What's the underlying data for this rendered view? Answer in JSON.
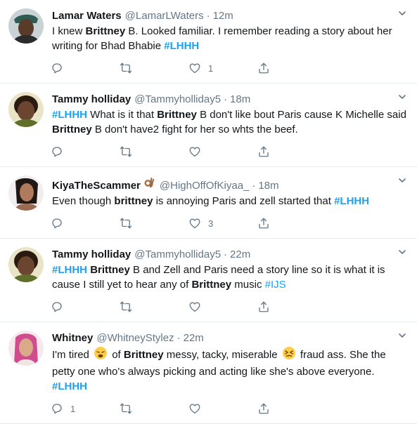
{
  "tweets": [
    {
      "name": "Lamar Waters",
      "handle": "@LamarLWaters",
      "dot": "·",
      "time": "12m",
      "parts": [
        {
          "t": "I knew "
        },
        {
          "t": "Brittney",
          "b": true
        },
        {
          "t": " B. Looked familiar. I remember reading a story about her writing for Bhad Bhabie "
        },
        {
          "t": "#LHHH",
          "tag": true,
          "bold": true
        }
      ],
      "replies": "",
      "retweets": "",
      "likes": "1"
    },
    {
      "name": "Tammy holliday",
      "handle": "@Tammyholliday5",
      "dot": "·",
      "time": "18m",
      "parts": [
        {
          "t": "#LHHH",
          "tag": true,
          "bold": true
        },
        {
          "t": " What is it that "
        },
        {
          "t": "Brittney",
          "b": true
        },
        {
          "t": " B don't like bout Paris cause K Michelle said "
        },
        {
          "t": "Brittney",
          "b": true
        },
        {
          "t": " B don't have2 fight for her so whts the beef."
        }
      ],
      "replies": "",
      "retweets": "",
      "likes": ""
    },
    {
      "name": "KiyaTheScammer",
      "handle": "@HighOffOfKiyaa_",
      "dot": "·",
      "time": "18m",
      "name_emoji": "ok-hand-emoji",
      "parts": [
        {
          "t": "Even though "
        },
        {
          "t": "brittney",
          "b": true
        },
        {
          "t": " is annoying Paris and zell started that "
        },
        {
          "t": "#LHHH",
          "tag": true,
          "bold": true
        }
      ],
      "replies": "",
      "retweets": "",
      "likes": "3"
    },
    {
      "name": "Tammy holliday",
      "handle": "@Tammyholliday5",
      "dot": "·",
      "time": "22m",
      "parts": [
        {
          "t": "#LHHH",
          "tag": true,
          "bold": true
        },
        {
          "t": " "
        },
        {
          "t": "Brittney",
          "b": true
        },
        {
          "t": " B and Zell and Paris need a story line so it is what it is cause I still yet to hear any of "
        },
        {
          "t": "Brittney",
          "b": true
        },
        {
          "t": " music "
        },
        {
          "t": "#IJS",
          "tag": true,
          "bold": false
        }
      ],
      "replies": "",
      "retweets": "",
      "likes": ""
    },
    {
      "name": "Whitney",
      "handle": "@WhitneyStylez",
      "dot": "·",
      "time": "22m",
      "parts": [
        {
          "t": "I'm tired "
        },
        {
          "emoji": "tired-face-emoji"
        },
        {
          "t": " of "
        },
        {
          "t": "Brittney",
          "b": true
        },
        {
          "t": " messy, tacky, miserable "
        },
        {
          "emoji": "persevering-face-emoji"
        },
        {
          "t": " fraud ass. She the petty one who's always picking and acting like she's above everyone.  "
        },
        {
          "t": "#LHHH",
          "tag": true,
          "bold": true
        }
      ],
      "replies": "1",
      "retweets": "",
      "likes": ""
    }
  ],
  "colors": {
    "accent": "#1da1f2",
    "muted": "#657786",
    "divider": "#e6ecf0"
  },
  "icons": {
    "reply": "reply-icon",
    "retweet": "retweet-icon",
    "like": "like-icon",
    "share": "share-icon",
    "more": "chevron-down-icon"
  }
}
